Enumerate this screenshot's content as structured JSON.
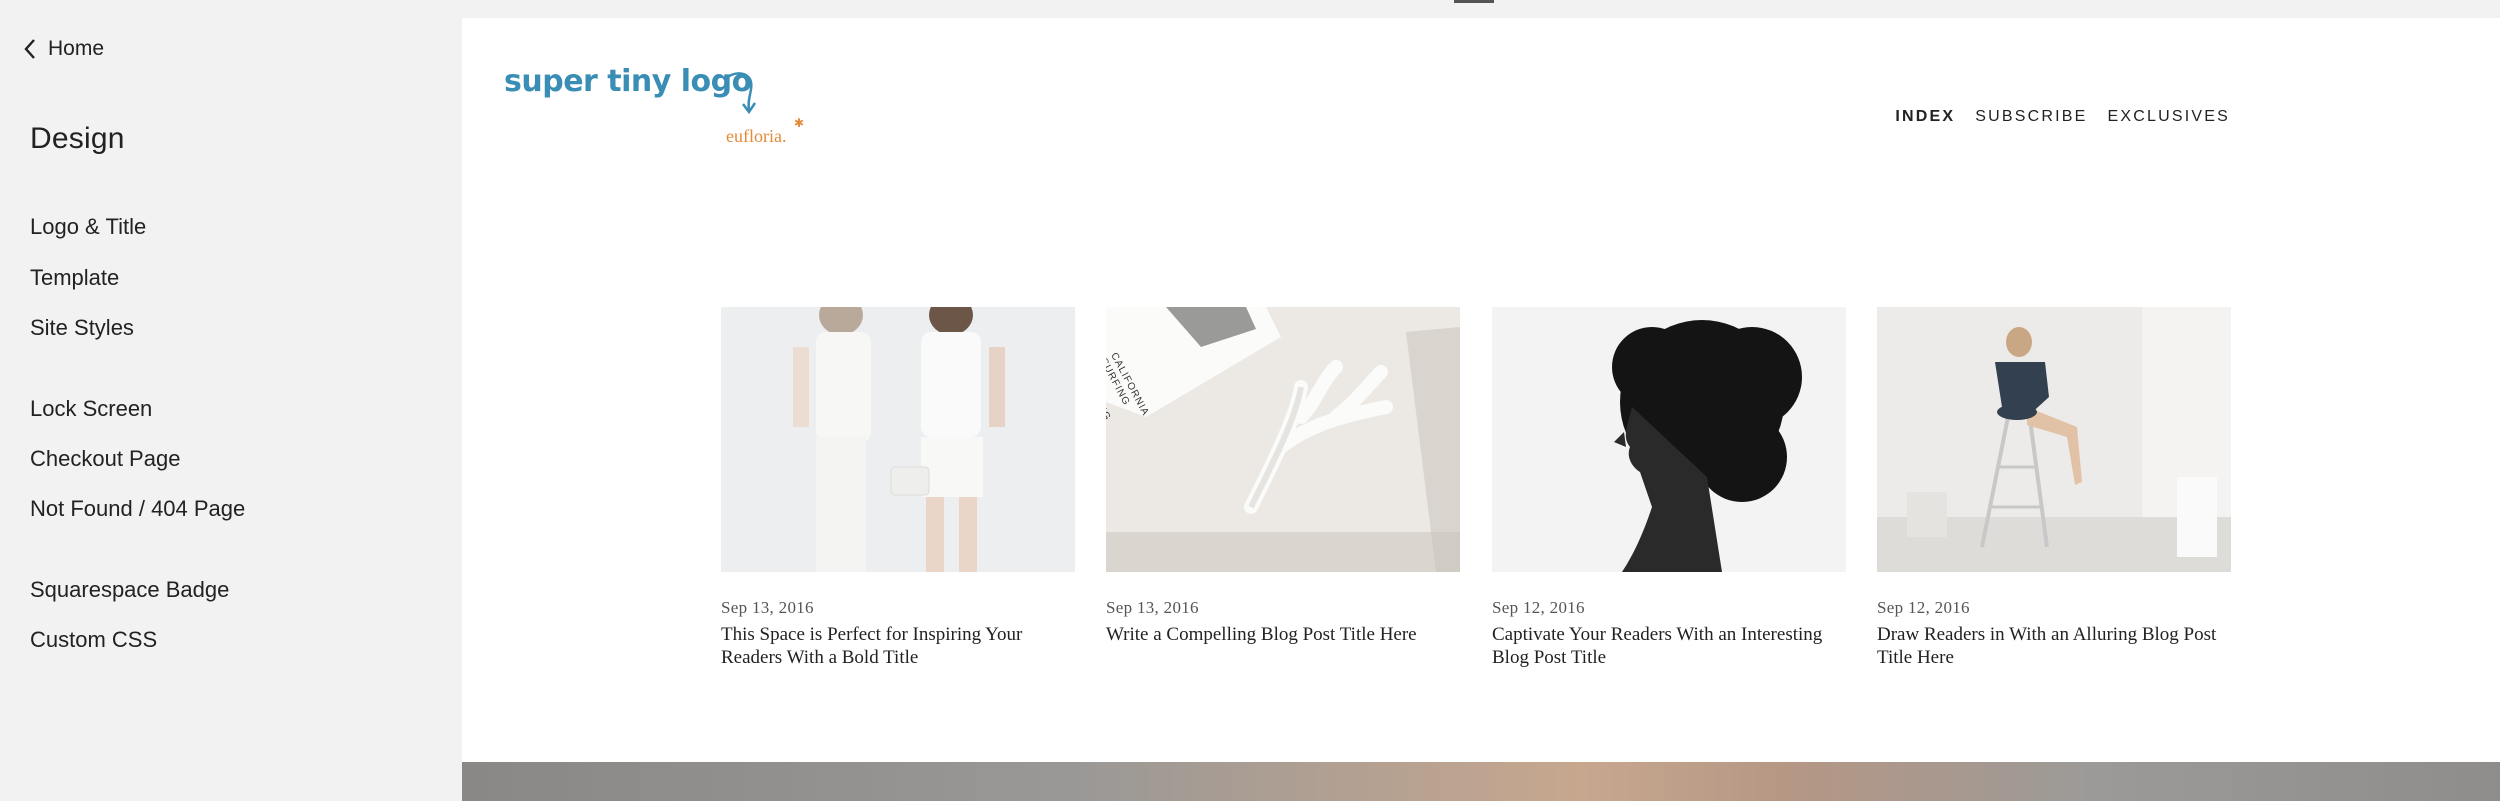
{
  "sidebar": {
    "back_label": "Home",
    "title": "Design",
    "items": [
      {
        "label": "Logo & Title"
      },
      {
        "label": "Template"
      },
      {
        "label": "Site Styles"
      },
      {
        "label": "Lock Screen"
      },
      {
        "label": "Checkout Page"
      },
      {
        "label": "Not Found / 404 Page"
      },
      {
        "label": "Squarespace Badge"
      },
      {
        "label": "Custom CSS"
      }
    ]
  },
  "site": {
    "logo_text": "super tiny logo",
    "logo_subtext": "eufloria.",
    "nav": [
      {
        "label": "INDEX",
        "active": true
      },
      {
        "label": "SUBSCRIBE",
        "active": false
      },
      {
        "label": "EXCLUSIVES",
        "active": false
      }
    ],
    "posts": [
      {
        "date": "Sep 13, 2016",
        "title": "This Space is Perfect for Inspiring Your Readers With a Bold Title"
      },
      {
        "date": "Sep 13, 2016",
        "title": "Write a Compelling Blog Post Title Here"
      },
      {
        "date": "Sep 12, 2016",
        "title": "Captivate Your Readers With an Interesting Blog Post Title"
      },
      {
        "date": "Sep 12, 2016",
        "title": "Draw Readers in With an Alluring Blog Post Title Here"
      }
    ],
    "book_cover_text": "CALIFORNIA SURFING AND CLIMBING IN THE FIFTIES"
  },
  "colors": {
    "logo_blue": "#3a8db5",
    "logo_orange": "#e58a3a",
    "sidebar_bg": "#f2f2f2"
  }
}
